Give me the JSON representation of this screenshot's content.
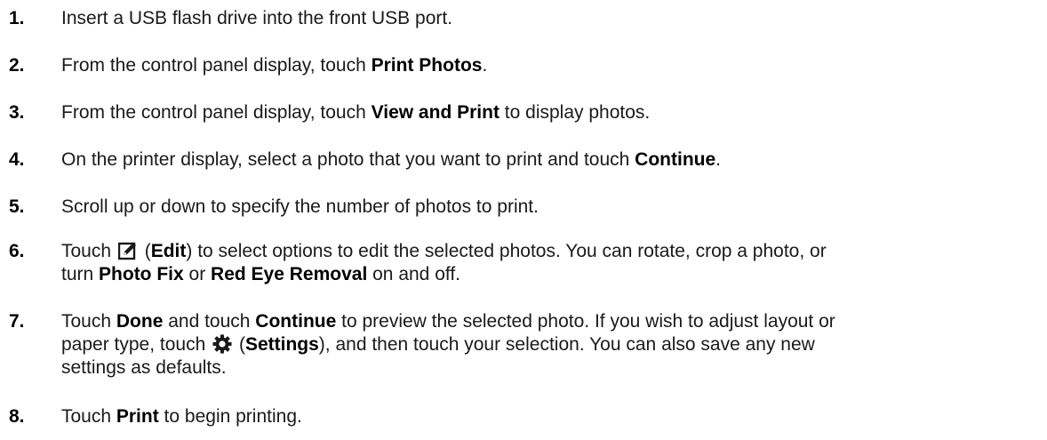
{
  "steps": [
    {
      "number": "1.",
      "text": "Insert a USB flash drive into the front USB port."
    },
    {
      "number": "2.",
      "before": "From the control panel display, touch ",
      "bold": "Print Photos",
      "after": "."
    },
    {
      "number": "3.",
      "before": "From the control panel display, touch ",
      "bold": "View and Print",
      "after": " to display photos."
    },
    {
      "number": "4.",
      "before": "On the printer display, select a photo that you want to print and touch ",
      "bold": "Continue",
      "after": "."
    },
    {
      "number": "5.",
      "text": "Scroll up or down to specify the number of photos to print."
    },
    {
      "number": "6.",
      "t1": "Touch ",
      "t2": " (",
      "b1": "Edit",
      "t3": ") to select options to edit the selected photos. You can rotate, crop a photo, or",
      "t4": "turn ",
      "b2": "Photo Fix",
      "t5": " or ",
      "b3": "Red Eye Removal",
      "t6": " on and off.",
      "icon": "edit-icon"
    },
    {
      "number": "7.",
      "t1": "Touch ",
      "b1": "Done",
      "t2": " and touch ",
      "b2": "Continue",
      "t3": " to preview the selected photo. If you wish to adjust layout or",
      "t4": "paper type, touch ",
      "t5": " (",
      "b3": "Settings",
      "t6": "), and then touch your selection. You can also save any new",
      "t7": "settings as defaults.",
      "icon": "settings-gear-icon"
    },
    {
      "number": "8.",
      "before": "Touch ",
      "bold": "Print",
      "after": " to begin printing."
    }
  ]
}
